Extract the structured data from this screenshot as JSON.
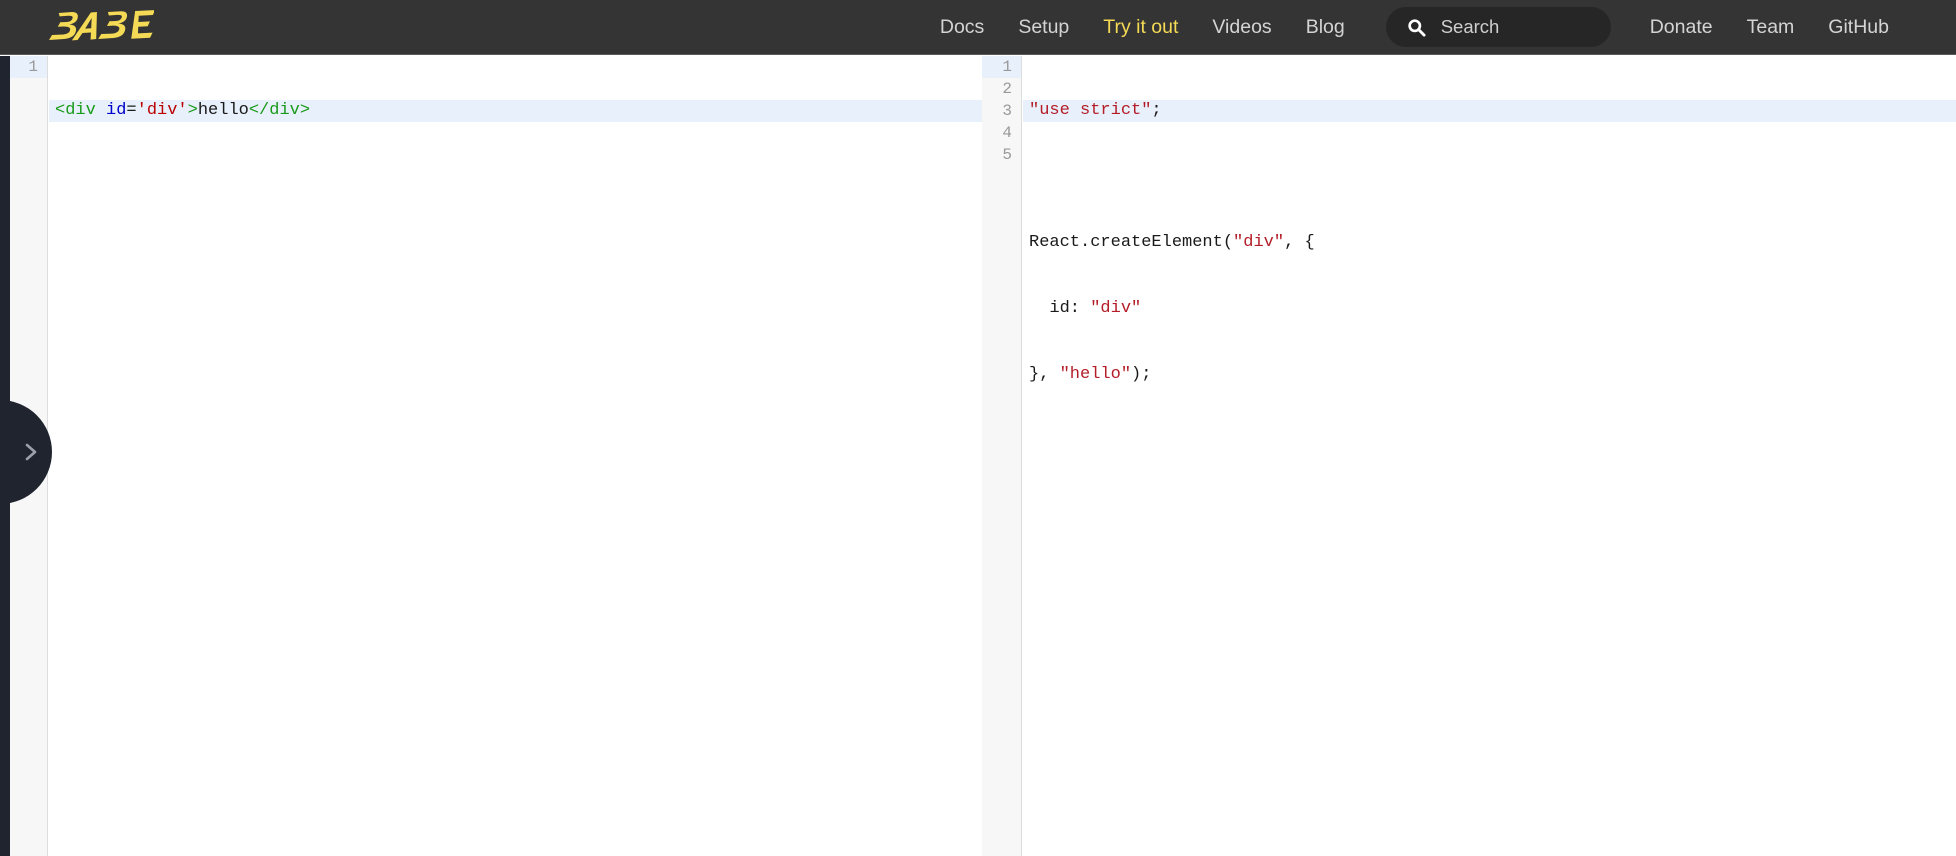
{
  "header": {
    "logo_text": "BABEL",
    "logo_color": "#f5da55",
    "background": "#343434",
    "nav_links": [
      {
        "label": "Docs",
        "active": false
      },
      {
        "label": "Setup",
        "active": false
      },
      {
        "label": "Try it out",
        "active": true
      },
      {
        "label": "Videos",
        "active": false
      },
      {
        "label": "Blog",
        "active": false
      }
    ],
    "search": {
      "icon": "search-icon",
      "placeholder": "Search",
      "value": ""
    },
    "right_links": [
      {
        "label": "Donate"
      },
      {
        "label": "Team"
      },
      {
        "label": "GitHub"
      }
    ]
  },
  "sidebar": {
    "toggle_icon": "chevron-right-icon",
    "background": "#20242e"
  },
  "editor": {
    "input": {
      "highlight_color": "#e8f0fb",
      "lines": [
        {
          "number": "1",
          "highlight": true
        }
      ],
      "line_1": {
        "open_tag": "<div",
        "attr_name": " id",
        "equals": "=",
        "attr_value": "'div'",
        "gt": ">",
        "text": "hello",
        "close_tag": "</div>"
      }
    },
    "output": {
      "highlight_color": "#e8f0fb",
      "lines": [
        {
          "number": "1",
          "highlight": true
        },
        {
          "number": "2",
          "highlight": false
        },
        {
          "number": "3",
          "highlight": false
        },
        {
          "number": "4",
          "highlight": false
        },
        {
          "number": "5",
          "highlight": false
        }
      ],
      "line_1_string": "\"use strict\"",
      "line_1_semi": ";",
      "line_2": "",
      "line_3_call": "React.createElement(",
      "line_3_string": "\"div\"",
      "line_3_rest": ", {",
      "line_4_key": "  id: ",
      "line_4_string": "\"div\"",
      "line_5_open": "}, ",
      "line_5_string": "\"hello\"",
      "line_5_close": ");"
    }
  }
}
